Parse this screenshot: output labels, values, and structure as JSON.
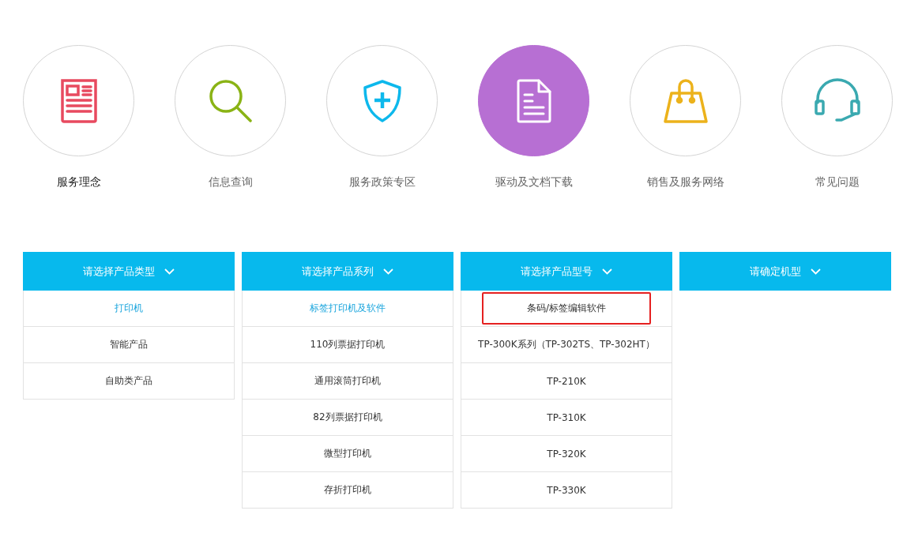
{
  "services": [
    {
      "label": "服务理念",
      "kind": "newspaper",
      "color": "#e84a5f",
      "selected": false,
      "hovered": true
    },
    {
      "label": "信息查询",
      "kind": "magnifier",
      "color": "#8ab315",
      "selected": false,
      "hovered": false
    },
    {
      "label": "服务政策专区",
      "kind": "shield",
      "color": "#0db8ec",
      "selected": false,
      "hovered": false
    },
    {
      "label": "驱动及文档下载",
      "kind": "file",
      "color": "#ffffff",
      "selected": true,
      "hovered": false
    },
    {
      "label": "销售及服务网络",
      "kind": "bag",
      "color": "#ecb21b",
      "selected": false,
      "hovered": false
    },
    {
      "label": "常见问题",
      "kind": "headset",
      "color": "#3aa9b0",
      "selected": false,
      "hovered": false
    }
  ],
  "selectors": [
    {
      "header": "请选择产品类型",
      "items": [
        {
          "label": "打印机",
          "selected": true,
          "outlined": false
        },
        {
          "label": "智能产品",
          "selected": false,
          "outlined": false
        },
        {
          "label": "自助类产品",
          "selected": false,
          "outlined": false
        }
      ]
    },
    {
      "header": "请选择产品系列",
      "items": [
        {
          "label": "标签打印机及软件",
          "selected": true,
          "outlined": false
        },
        {
          "label": "110列票据打印机",
          "selected": false,
          "outlined": false
        },
        {
          "label": "通用滚筒打印机",
          "selected": false,
          "outlined": false
        },
        {
          "label": "82列票据打印机",
          "selected": false,
          "outlined": false
        },
        {
          "label": "微型打印机",
          "selected": false,
          "outlined": false
        },
        {
          "label": "存折打印机",
          "selected": false,
          "outlined": false
        }
      ]
    },
    {
      "header": "请选择产品型号",
      "items": [
        {
          "label": "条码/标签编辑软件",
          "selected": false,
          "outlined": true
        },
        {
          "label": "TP-300K系列（TP-302TS、TP-302HT）",
          "selected": false,
          "outlined": false
        },
        {
          "label": "TP-210K",
          "selected": false,
          "outlined": false
        },
        {
          "label": "TP-310K",
          "selected": false,
          "outlined": false
        },
        {
          "label": "TP-320K",
          "selected": false,
          "outlined": false
        },
        {
          "label": "TP-330K",
          "selected": false,
          "outlined": false
        }
      ]
    },
    {
      "header": "请确定机型"
    }
  ]
}
